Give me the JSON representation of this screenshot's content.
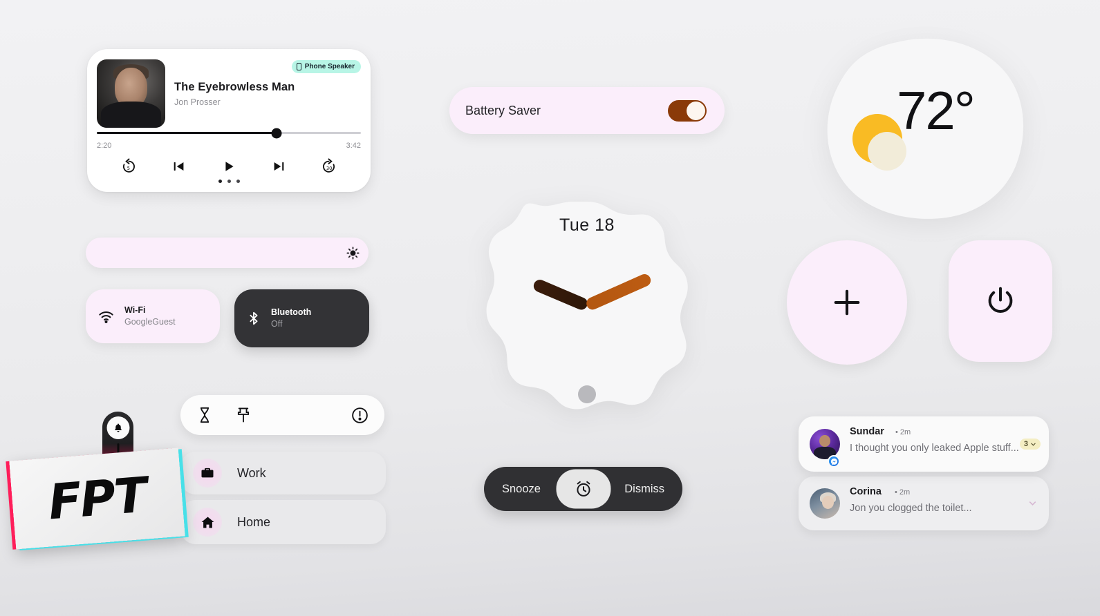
{
  "media": {
    "title": "The Eyebrowless Man",
    "artist": "Jon Prosser",
    "output_chip": "Phone Speaker",
    "output_chip_icon": "phone-icon",
    "output_chip_color": "#b8f5e6",
    "elapsed": "2:20",
    "total": "3:42",
    "progress_percent": 68,
    "controls": [
      {
        "name": "replay-5-icon",
        "label": "5"
      },
      {
        "name": "previous-track-icon",
        "label": ""
      },
      {
        "name": "play-icon",
        "label": ""
      },
      {
        "name": "next-track-icon",
        "label": ""
      },
      {
        "name": "forward-30-icon",
        "label": "30"
      }
    ],
    "page_dots": 3
  },
  "brightness": {
    "icon": "brightness-icon",
    "level_percent": 100,
    "color": "#fbeefb"
  },
  "quick_tiles": [
    {
      "name": "wifi-tile",
      "icon": "wifi-icon",
      "label": "Wi-Fi",
      "sublabel": "GoogleGuest",
      "state": "on",
      "color": "#fbeefb"
    },
    {
      "name": "bluetooth-tile",
      "icon": "bluetooth-icon",
      "label": "Bluetooth",
      "sublabel": "Off",
      "state": "off",
      "color": "#333336"
    }
  ],
  "battery_saver": {
    "label": "Battery Saver",
    "toggle_state": "on",
    "toggle_color": "#8a3a08",
    "card_color": "#fbeefb"
  },
  "clock": {
    "date": "Tue 18",
    "hour_hand_degrees": 203,
    "minute_hand_degrees": -24,
    "hand_color_hour": "#3b1d0c",
    "hand_color_minute": "#b35711"
  },
  "alarm": {
    "snooze_label": "Snooze",
    "dismiss_label": "Dismiss",
    "center_icon": "alarm-clock-icon",
    "bar_color": "#303033"
  },
  "weather": {
    "temperature": "72°",
    "icon": "sun-behind-cloud-icon",
    "sun_color": "#f9bb24",
    "cloud_color": "#f2ecd9"
  },
  "action_buttons": [
    {
      "name": "add-button",
      "icon": "plus-icon",
      "shape": "circle",
      "color": "#fbeefb"
    },
    {
      "name": "power-button",
      "icon": "power-icon",
      "shape": "rounded-square",
      "color": "#fbeefb"
    }
  ],
  "notifications": [
    {
      "sender": "Sundar",
      "time": "• 2m",
      "message": "I thought you only leaked Apple stuff...",
      "app_badge": "messenger-icon",
      "count_badge": "3",
      "count_badge_color": "#f4eec3",
      "expand_icon": "chevron-down-icon"
    },
    {
      "sender": "Corina",
      "time": "• 2m",
      "message": "Jon you clogged the toilet...",
      "app_badge": "",
      "count_badge": "",
      "count_badge_color": "",
      "expand_icon": "chevron-down-icon"
    }
  ],
  "quick_toolbar": {
    "items": [
      {
        "name": "hourglass-icon"
      },
      {
        "name": "pin-icon"
      },
      {
        "name": "alert-circle-icon"
      }
    ]
  },
  "place_rows": [
    {
      "name": "work-row",
      "icon": "briefcase-icon",
      "label": "Work"
    },
    {
      "name": "home-row",
      "icon": "home-icon",
      "label": "Home"
    }
  ],
  "watermark": {
    "text": "FPT",
    "bell_icon": "bell-icon",
    "accent_pink": "#ff1e5a",
    "accent_cyan": "#48e0e8"
  }
}
